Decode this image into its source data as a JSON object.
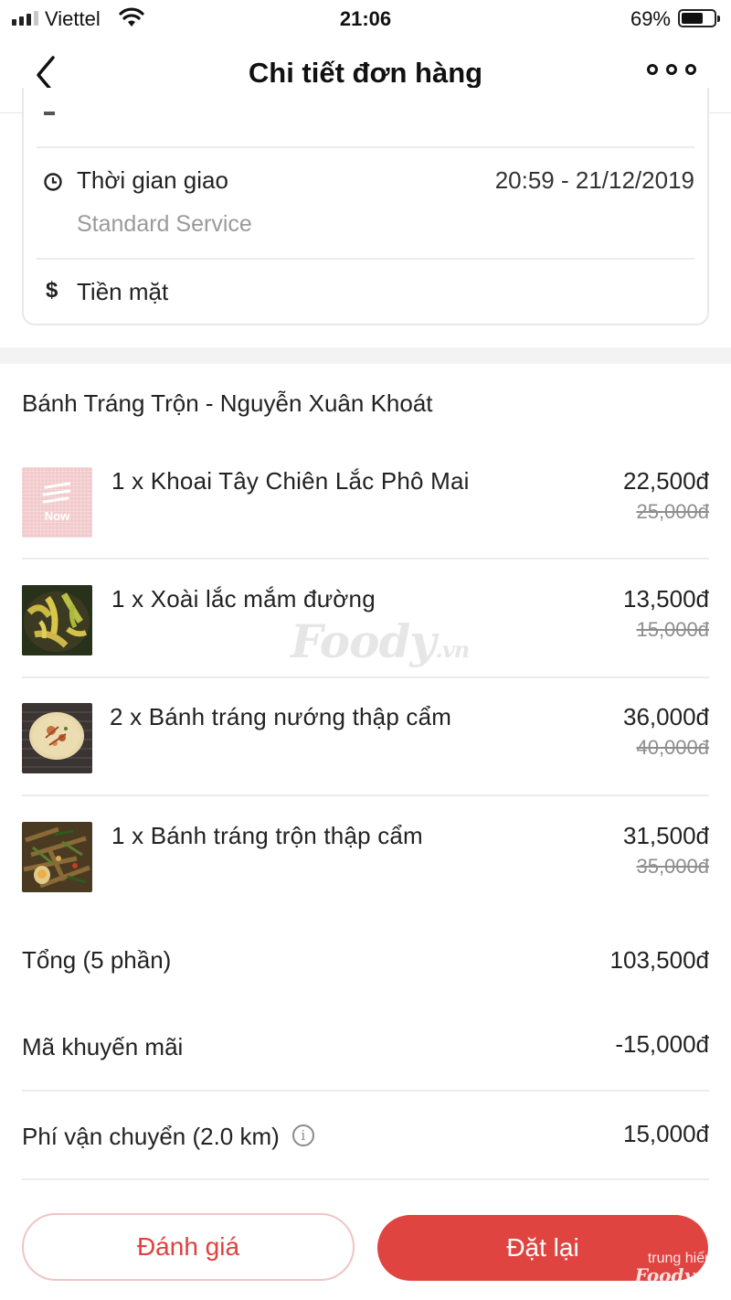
{
  "status_bar": {
    "carrier": "Viettel",
    "time": "21:06",
    "battery_percent": "69%",
    "battery_level": 0.69,
    "icons": [
      "signal-icon",
      "wifi-icon",
      "battery-icon"
    ]
  },
  "nav": {
    "title": "Chi tiết đơn hàng",
    "back_icon": "chevron-left-icon",
    "more_icon": "more-dots-icon"
  },
  "delivery_info": {
    "time_label": "Thời gian giao",
    "time_value": "20:59 - 21/12/2019",
    "service": "Standard Service",
    "payment_label": "Tiền mặt",
    "time_icon": "clock-icon",
    "payment_icon": "dollar-icon"
  },
  "restaurant": {
    "name": "Bánh Tráng Trộn - Nguyễn Xuân Khoát"
  },
  "items": [
    {
      "name": "1 x Khoai Tây Chiên Lắc Phô Mai",
      "price": "22,500đ",
      "old_price": "25,000đ",
      "thumb_label": "Now"
    },
    {
      "name": "1 x Xoài lắc mắm đường",
      "price": "13,500đ",
      "old_price": "15,000đ"
    },
    {
      "name": "2 x Bánh tráng nướng thập cẩm",
      "price": "36,000đ",
      "old_price": "40,000đ"
    },
    {
      "name": "1 x Bánh tráng trộn thập cẩm",
      "price": "31,500đ",
      "old_price": "35,000đ"
    }
  ],
  "summary": {
    "total_label": "Tổng (5 phần)",
    "total_value": "103,500đ",
    "promo_label": "Mã khuyến mãi",
    "promo_value": "-15,000đ",
    "shipping_label": "Phí vận chuyển (2.0 km)",
    "shipping_value": "15,000đ",
    "shipping_info_icon": "info-icon"
  },
  "actions": {
    "rate_label": "Đánh giá",
    "reorder_label": "Đặt lại"
  },
  "watermarks": {
    "center_logo": "Foody",
    "center_logo_suffix": ".vn",
    "corner_user": "trung hiếu",
    "corner_brand": "Foody",
    "corner_brand_suffix": ".vn"
  },
  "colors": {
    "accent": "#e04441",
    "muted_text": "#9a9a9a",
    "divider": "#ececec"
  }
}
